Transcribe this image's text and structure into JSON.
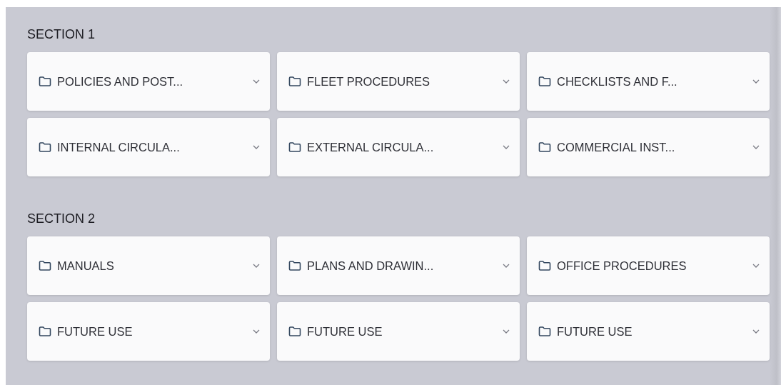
{
  "sections": [
    {
      "title": "SECTION 1",
      "folders": [
        {
          "label": "POLICIES AND POST..."
        },
        {
          "label": "FLEET PROCEDURES"
        },
        {
          "label": "CHECKLISTS AND F..."
        },
        {
          "label": "INTERNAL CIRCULA..."
        },
        {
          "label": "EXTERNAL CIRCULA..."
        },
        {
          "label": "COMMERCIAL INST..."
        }
      ]
    },
    {
      "title": "SECTION 2",
      "folders": [
        {
          "label": "MANUALS"
        },
        {
          "label": "PLANS AND DRAWIN..."
        },
        {
          "label": "OFFICE PROCEDURES"
        },
        {
          "label": "FUTURE USE"
        },
        {
          "label": "FUTURE USE"
        },
        {
          "label": "FUTURE USE"
        }
      ]
    }
  ]
}
